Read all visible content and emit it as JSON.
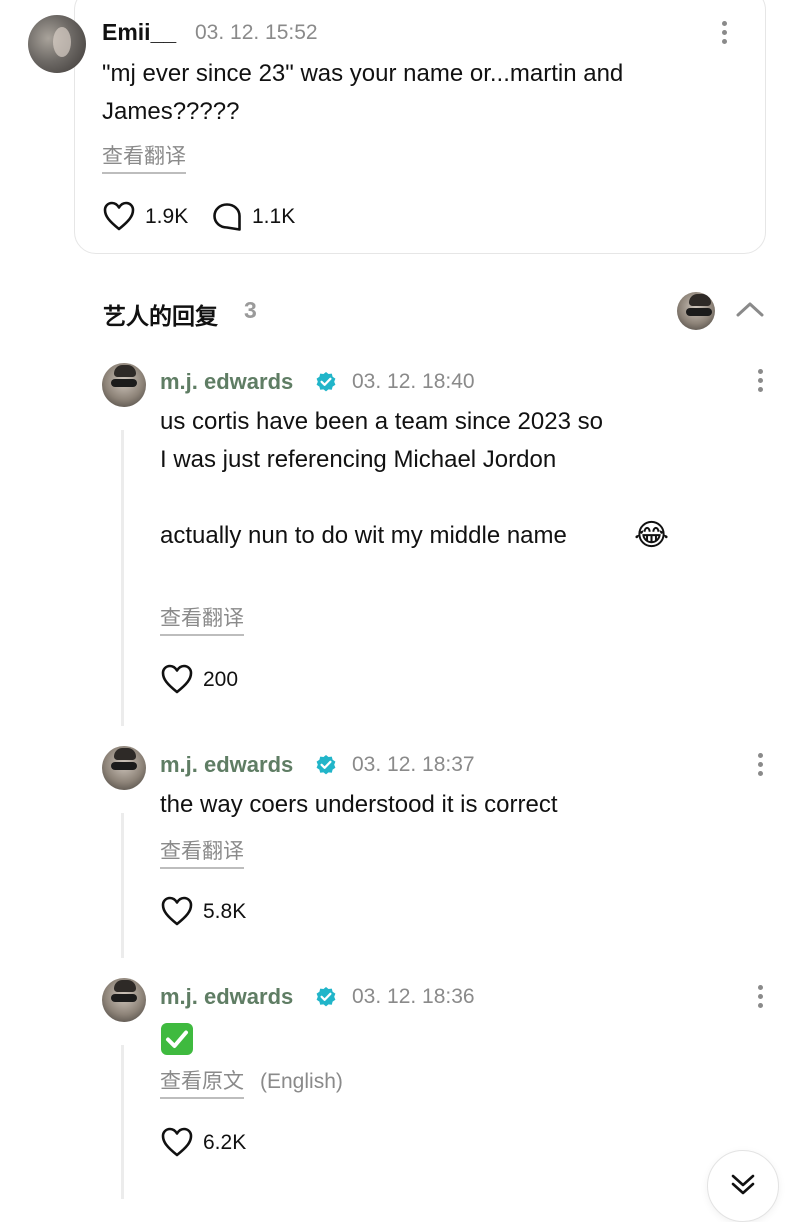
{
  "top_comment": {
    "author": "Emii__",
    "time": "03. 12. 15:52",
    "text_line1": "\"mj ever since 23\" was your name or...martin and",
    "text_line2": "James?????",
    "translate": "查看翻译",
    "likes": "1.9K",
    "replies": "1.1K"
  },
  "artist_replies": {
    "title": "艺人的回复",
    "count": "3"
  },
  "replies": [
    {
      "author": "m.j. edwards",
      "time": "03. 12. 18:40",
      "line1": "us cortis have been a team since 2023 so",
      "line2": "I was just referencing Michael Jordon",
      "line3": "actually nun to do wit my middle name",
      "emoji": "😂",
      "translate": "查看翻译",
      "likes": "200"
    },
    {
      "author": "m.j. edwards",
      "time": "03. 12. 18:37",
      "line1": "the way coers understood it is correct",
      "translate": "查看翻译",
      "likes": "5.8K"
    },
    {
      "author": "m.j. edwards",
      "time": "03. 12. 18:36",
      "emoji": "✅",
      "translate": "查看原文",
      "translate_suffix": "(English)",
      "likes": "6.2K"
    }
  ],
  "colors": {
    "verified": "#21b5c9",
    "author_green": "#5f7d64",
    "muted": "#8a8a8a"
  }
}
